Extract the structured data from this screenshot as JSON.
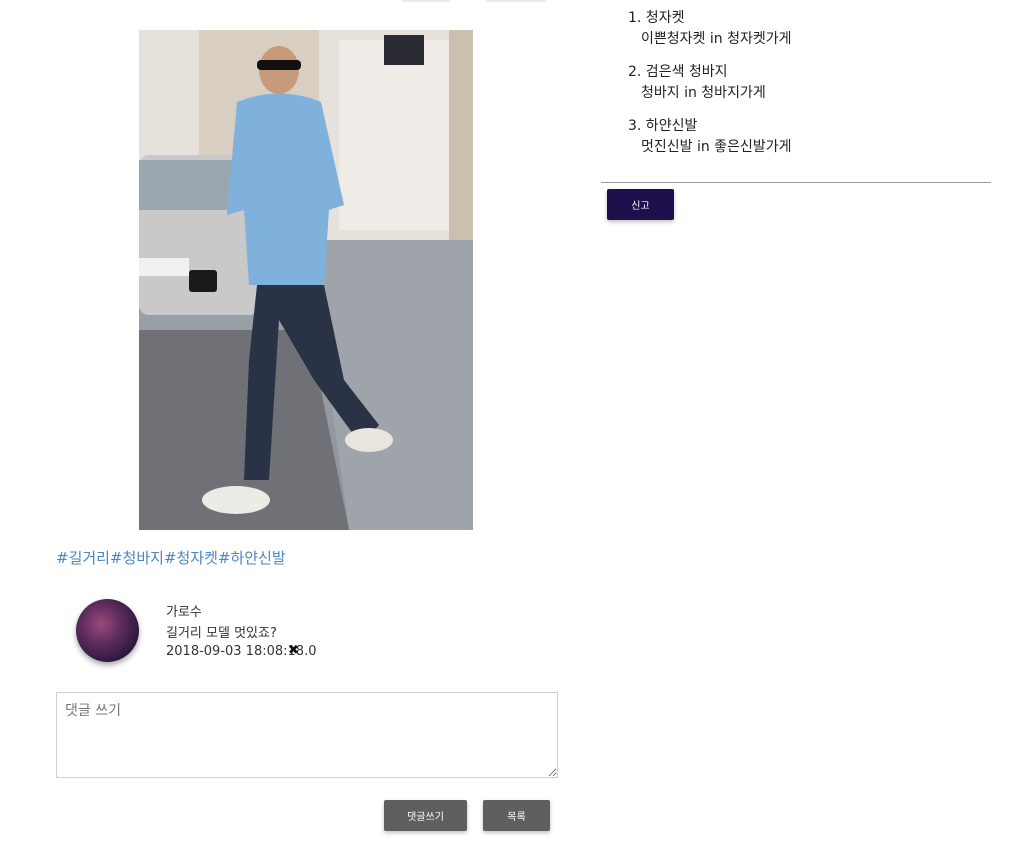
{
  "post": {
    "hashtags": [
      "#길거리",
      "#청바지",
      "#청자켓",
      "#하얀신발"
    ]
  },
  "comment": {
    "author": "가로수",
    "text": "길거리 모델 멋있죠?",
    "date": "2018-09-03 18:08:18.0",
    "delete_icon": "✖"
  },
  "comment_form": {
    "placeholder": "댓글 쓰기",
    "submit_label": "댓글쓰기",
    "list_label": "목록"
  },
  "products": [
    {
      "name": "1. 청자켓",
      "detail": "이쁜청자켓 in 청자켓가게"
    },
    {
      "name": "2. 검은색 청바지",
      "detail": "청바지 in 청바지가게"
    },
    {
      "name": "3. 하얀신발",
      "detail": "멋진신발 in 좋은신발가게"
    }
  ],
  "report_label": "신고",
  "colors": {
    "hashtag": "#4a86c8",
    "report_button": "#1e0f4d",
    "gray_button": "#5f5f5f"
  }
}
